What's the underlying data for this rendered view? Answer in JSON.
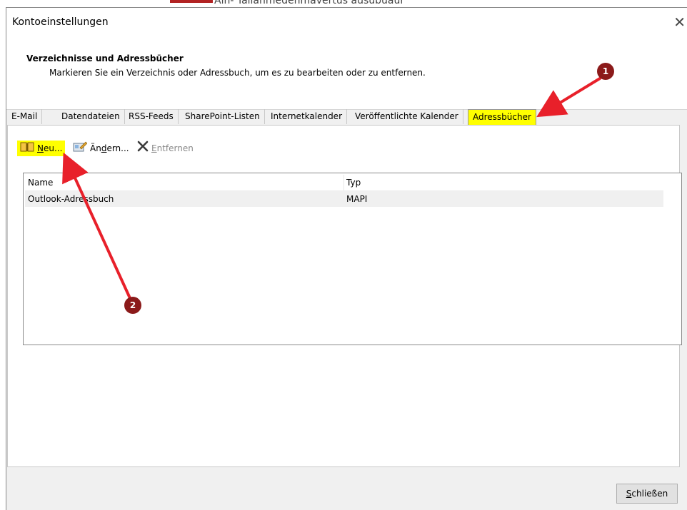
{
  "background_text": "Ain- Tallanmedenmavertus ausubuaur",
  "window": {
    "title": "Kontoeinstellungen",
    "close_icon": "close-icon"
  },
  "header": {
    "title": "Verzeichnisse und Adressbücher",
    "subtitle": "Markieren Sie ein Verzeichnis oder Adressbuch, um es zu bearbeiten oder zu entfernen."
  },
  "tabs": [
    {
      "label": "E-Mail"
    },
    {
      "label": "Datendateien"
    },
    {
      "label": "RSS-Feeds"
    },
    {
      "label": "SharePoint-Listen"
    },
    {
      "label": "Internetkalender"
    },
    {
      "label": "Veröffentlichte Kalender"
    },
    {
      "label": "Adressbücher",
      "active": true
    }
  ],
  "toolbar": {
    "new": {
      "label_u": "N",
      "label_rest": "eu...",
      "icon": "address-book-icon"
    },
    "edit": {
      "label_pre": "Än",
      "label_u": "d",
      "label_rest": "ern...",
      "icon": "edit-card-icon"
    },
    "remove": {
      "label_u": "E",
      "label_rest": "ntfernen",
      "icon": "delete-x-icon"
    }
  },
  "list": {
    "columns": [
      "Name",
      "Typ"
    ],
    "rows": [
      {
        "name": "Outlook-Adressbuch",
        "type": "MAPI"
      }
    ]
  },
  "footer": {
    "close_u": "S",
    "close_rest": "chließen"
  },
  "annotations": [
    {
      "label": "1"
    },
    {
      "label": "2"
    }
  ],
  "colors": {
    "highlight": "#ffff00",
    "arrow": "#e8202a",
    "badge": "#8b1a1a"
  }
}
